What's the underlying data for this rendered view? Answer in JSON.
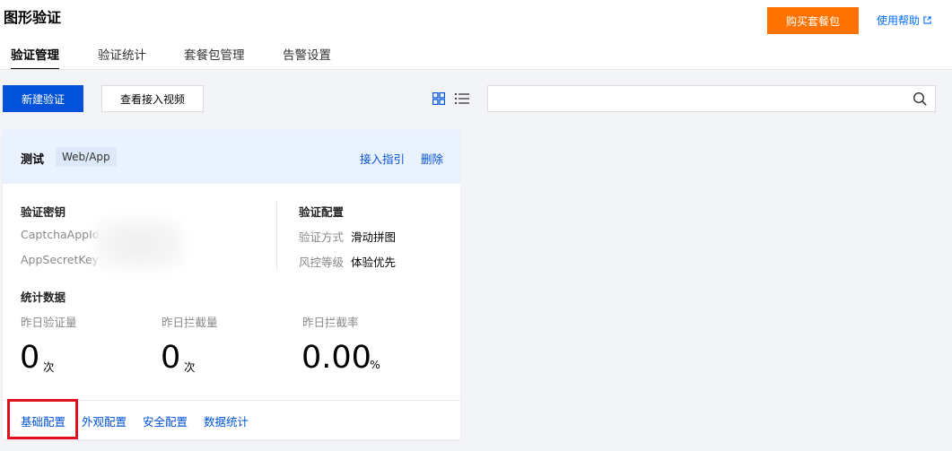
{
  "header": {
    "title": "图形验证",
    "buy_label": "购买套餐包",
    "help_label": "使用帮助"
  },
  "tabs": [
    {
      "label": "验证管理",
      "active": true
    },
    {
      "label": "验证统计",
      "active": false
    },
    {
      "label": "套餐包管理",
      "active": false
    },
    {
      "label": "告警设置",
      "active": false
    }
  ],
  "toolbar": {
    "new_label": "新建验证",
    "video_label": "查看接入视频",
    "search_placeholder": ""
  },
  "card": {
    "name": "测试",
    "tag": "Web/App",
    "guide_link": "接入指引",
    "delete_link": "删除",
    "keys": {
      "title": "验证密钥",
      "app_id_label": "CaptchaAppId",
      "app_secret_label": "AppSecretKey"
    },
    "config": {
      "title": "验证配置",
      "method_label": "验证方式",
      "method_value": "滑动拼图",
      "risk_label": "风控等级",
      "risk_value": "体验优先"
    },
    "stats": {
      "title": "统计数据",
      "items": [
        {
          "label": "昨日验证量",
          "value": "0",
          "unit": "次"
        },
        {
          "label": "昨日拦截量",
          "value": "0",
          "unit": "次"
        },
        {
          "label": "昨日拦截率",
          "value": "0.00",
          "unit": "%"
        }
      ]
    },
    "footer_links": [
      "基础配置",
      "外观配置",
      "安全配置",
      "数据统计"
    ]
  },
  "colors": {
    "primary": "#0052d9",
    "orange": "#ff7200",
    "highlight": "#e0101d",
    "card_header": "#ebf2ff"
  }
}
